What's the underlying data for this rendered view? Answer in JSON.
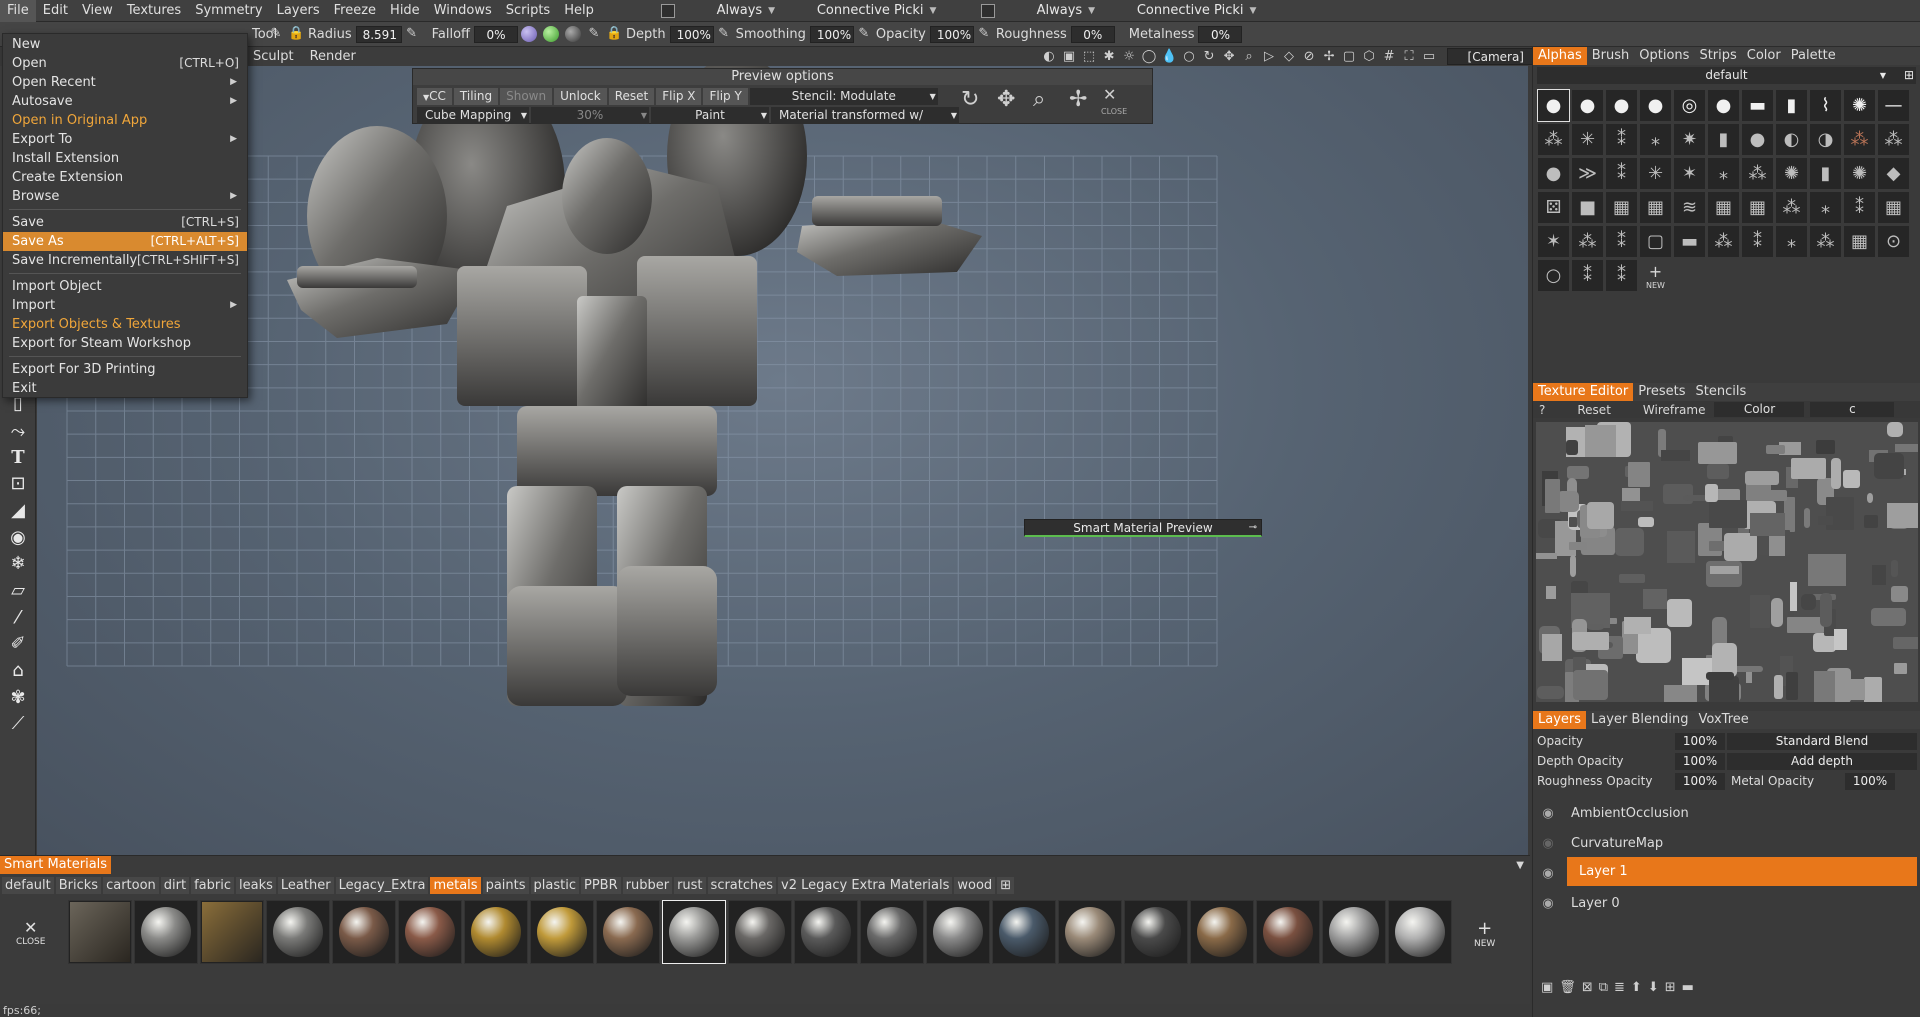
{
  "menubar": {
    "items": [
      "File",
      "Edit",
      "View",
      "Textures",
      "Symmetry",
      "Layers",
      "Freeze",
      "Hide",
      "Windows",
      "Scripts",
      "Help"
    ],
    "dropdown1": "Always",
    "dropdown2": "Connective Picki",
    "dropdown3": "Always",
    "dropdown4": "Connective Picki"
  },
  "toolbar": {
    "tool_label": "Tool",
    "radius_label": "Radius",
    "radius_value": "8.591",
    "falloff_label": "Falloff",
    "falloff_value": "0%",
    "depth_label": "Depth",
    "depth_value": "100%",
    "smoothing_label": "Smoothing",
    "smoothing_value": "100%",
    "opacity_label": "Opacity",
    "opacity_value": "100%",
    "roughness_label": "Roughness",
    "roughness_value": "0%",
    "metalness_label": "Metalness",
    "metalness_value": "0%"
  },
  "toolbar2": {
    "sculpt": "Sculpt",
    "render": "Render",
    "camera": "[Camera]"
  },
  "file_menu": {
    "new": "New",
    "open": "Open",
    "open_short": "[CTRL+O]",
    "open_recent": "Open Recent",
    "autosave": "Autosave",
    "open_original": "Open in Original App",
    "export_to": "Export To",
    "install_ext": "Install Extension",
    "create_ext": "Create Extension",
    "browse": "Browse",
    "save": "Save",
    "save_short": "[CTRL+S]",
    "save_as": "Save As",
    "save_as_short": "[CTRL+ALT+S]",
    "save_inc": "Save Incrementally",
    "save_inc_short": "[CTRL+SHIFT+S]",
    "import_obj": "Import Object",
    "import": "Import",
    "export_obj_tex": "Export Objects & Textures",
    "export_steam": "Export for Steam Workshop",
    "export_3d": "Export For 3D Printing",
    "exit": "Exit"
  },
  "preview": {
    "title": "Preview options",
    "cc": "CC",
    "tiling": "Tiling",
    "shown": "Shown",
    "unlock": "Unlock",
    "reset": "Reset",
    "flip_x": "Flip X",
    "flip_y": "Flip Y",
    "stencil": "Stencil: Modulate",
    "cube_mapping": "Cube Mapping",
    "percent": "30%",
    "paint": "Paint",
    "material": "Material transformed w/",
    "close": "CLOSE"
  },
  "smart_material_preview": "Smart Material Preview",
  "right_panel": {
    "alpha_tabs": [
      "Alphas",
      "Brush",
      "Options",
      "Strips",
      "Color",
      "Palette"
    ],
    "alpha_set": "default",
    "alpha_new": "NEW",
    "tex_tabs": [
      "Texture Editor",
      "Presets",
      "Stencils"
    ],
    "tex_q": "?",
    "tex_reset": "Reset",
    "tex_wireframe": "Wireframe",
    "tex_color": "Color",
    "tex_c": "c",
    "layer_tabs": [
      "Layers",
      "Layer Blending",
      "VoxTree"
    ],
    "opacity_label": "Opacity",
    "opacity_value": "100%",
    "blend": "Standard Blend",
    "depth_opacity_label": "Depth Opacity",
    "depth_opacity_value": "100%",
    "add_depth": "Add depth",
    "rough_opacity_label": "Roughness Opacity",
    "rough_opacity_value": "100%",
    "metal_opacity_label": "Metal Opacity",
    "metal_opacity_value": "100%",
    "layers": [
      "AmbientOcclusion",
      "CurvatureMap",
      "Layer 1",
      "Layer 0"
    ]
  },
  "smart_materials": {
    "title": "Smart Materials",
    "categories": [
      "default",
      "Bricks",
      "cartoon",
      "dirt",
      "fabric",
      "leaks",
      "Leather",
      "Legacy_Extra",
      "metals",
      "paints",
      "plastic",
      "PPBR",
      "rubber",
      "rust",
      "scratches",
      "v2 Legacy Extra Materials",
      "wood"
    ],
    "active_category": "metals",
    "close": "CLOSE",
    "new": "NEW",
    "thumb_colors": [
      "#6b655a",
      "#8a8a88",
      "#8a6e3a",
      "#7a7a78",
      "#7a5a48",
      "#8a5a48",
      "#b08a30",
      "#c09a3a",
      "#8a6a50",
      "#9a9a98",
      "#6a6866",
      "#5a5a5a",
      "#6a6a6a",
      "#8a8a8a",
      "#4a5a6a",
      "#9a8a78",
      "#4a4a4a",
      "#8a6a48",
      "#7a5040",
      "#a0a0a0",
      "#b0b0b0"
    ]
  },
  "status": "fps:66;"
}
